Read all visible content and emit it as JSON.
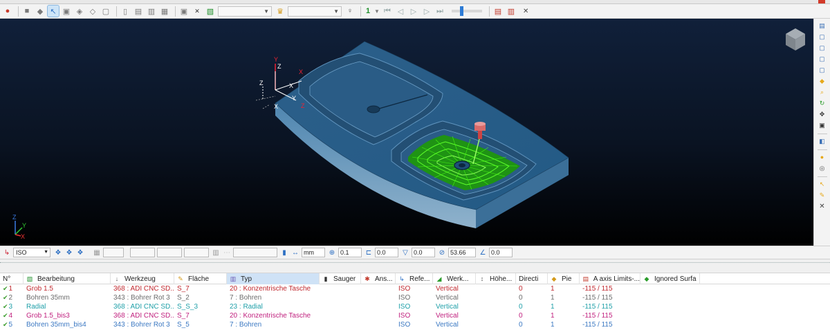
{
  "toolbar": {
    "combo1_value": "",
    "combo2_value": "",
    "count_value": "1",
    "icons": [
      "record-icon",
      "cube-icon",
      "cube-icon",
      "select-icon",
      "cube-icon",
      "cube-icon",
      "cube-icon",
      "sheet-icon",
      "sheet-icon",
      "sheet-icon",
      "sheet-icon",
      "frame-icon",
      "close-icon",
      "toolpath-icon",
      "dropdown-icon",
      "crown-icon",
      "bulb-icon",
      "step-icon",
      "rewind-icon",
      "prev-icon",
      "play-icon",
      "next-icon",
      "end-icon",
      "op-list-icon",
      "op-edit-icon",
      "close-icon"
    ]
  },
  "status": {
    "view_mode": "ISO",
    "unit": "mm",
    "step1": "0.1",
    "step2": "0.0",
    "step3": "0.0",
    "angle": "53.66",
    "step4": "0.0"
  },
  "grid": {
    "columns": [
      {
        "label": "N°",
        "icon": ""
      },
      {
        "label": "Bearbeitung",
        "icon": "toolpath-icon"
      },
      {
        "label": "Werkzeug",
        "icon": "tool-icon"
      },
      {
        "label": "Fläche",
        "icon": "surface-icon"
      },
      {
        "label": "Typ",
        "icon": "type-icon"
      },
      {
        "label": "Sauger",
        "icon": "suction-icon"
      },
      {
        "label": "Ans...",
        "icon": "approach-icon"
      },
      {
        "label": "Refe...",
        "icon": "reference-icon"
      },
      {
        "label": "Werk...",
        "icon": "workplane-icon"
      },
      {
        "label": "Höhe...",
        "icon": "height-icon"
      },
      {
        "label": "Directi",
        "icon": ""
      },
      {
        "label": "Pie",
        "icon": "piece-icon"
      },
      {
        "label": "A axis Limits-...",
        "icon": "axis-icon"
      },
      {
        "label": "Ignored Surfa",
        "icon": "ignore-icon"
      }
    ],
    "rows": [
      {
        "color": "#c0282e",
        "n": "1",
        "bearbeitung": "Grob 1.5",
        "werkzeug": "368 : ADI CNC SD...",
        "flaeche": "S_7",
        "typ": "20 : Konzentrische Tasche",
        "ref": "ISO",
        "werk": "Vertical",
        "dir": "0",
        "pie": "1",
        "axis": "-115 / 115"
      },
      {
        "color": "#6b6b6b",
        "n": "2",
        "bearbeitung": "Bohren 35mm",
        "werkzeug": "343 : Bohrer Rot 3",
        "flaeche": "S_2",
        "typ": "7 : Bohren",
        "ref": "ISO",
        "werk": "Vertical",
        "dir": "0",
        "pie": "1",
        "axis": "-115 / 115"
      },
      {
        "color": "#1e9fa8",
        "n": "3",
        "bearbeitung": "Radial",
        "werkzeug": "368 : ADI CNC SD...",
        "flaeche": "S_S_3",
        "typ": "23 : Radial",
        "ref": "ISO",
        "werk": "Vertical",
        "dir": "0",
        "pie": "1",
        "axis": "-115 / 115"
      },
      {
        "color": "#c0207e",
        "n": "4",
        "bearbeitung": "Grob 1.5_bis3",
        "werkzeug": "368 : ADI CNC SD...",
        "flaeche": "S_7",
        "typ": "20 : Konzentrische Tasche",
        "ref": "ISO",
        "werk": "Vertical",
        "dir": "0",
        "pie": "1",
        "axis": "-115 / 115"
      },
      {
        "color": "#3b78c2",
        "n": "5",
        "bearbeitung": "Bohren 35mm_bis4",
        "werkzeug": "343 : Bohrer Rot 3",
        "flaeche": "S_5",
        "typ": "7 : Bohren",
        "ref": "ISO",
        "werk": "Vertical",
        "dir": "0",
        "pie": "1",
        "axis": "-115 / 115"
      }
    ]
  },
  "viewport": {
    "part_color": "#2f6a96",
    "toolpath_color": "#3cff00",
    "axis_labels": [
      "Y",
      "Z",
      "X",
      "Y",
      "Z",
      "X",
      "Z",
      "X"
    ],
    "triad_labels": [
      "Z",
      "Y",
      "X"
    ]
  }
}
